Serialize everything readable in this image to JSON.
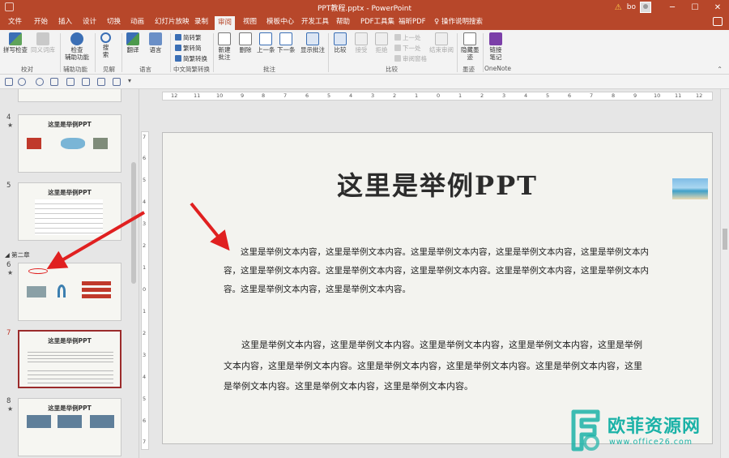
{
  "window": {
    "title": "PPT教程.pptx  -  PowerPoint",
    "user": "bo",
    "controls": [
      "─",
      "☐",
      "✕"
    ]
  },
  "tabs": [
    "文件",
    "开始",
    "插入",
    "设计",
    "切换",
    "动画",
    "幻灯片放映",
    "录制",
    "审阅",
    "视图",
    "模板中心",
    "开发工具",
    "帮助",
    "PDF工具集",
    "福昕PDF"
  ],
  "active_tab": "审阅",
  "tell_me": "操作说明搜索",
  "ribbon": {
    "spelling": "拼写检查",
    "thesaurus": "同义词库",
    "check_accessibility": [
      "检查",
      "辅助功能"
    ],
    "smart_lookup": [
      "搜",
      "索"
    ],
    "translate": "翻译",
    "language": "语言",
    "to_traditional": "简转繁",
    "to_simplified": "繁转简",
    "convert": "简繁转换",
    "new_comment": [
      "新建",
      "批注"
    ],
    "delete": "删除",
    "previous": "上一条",
    "next": "下一条",
    "show_comments": "显示批注",
    "compare": "比较",
    "accept": "接受",
    "reject": "拒绝",
    "prev_change": "上一处",
    "next_change": "下一处",
    "reviewing_pane": "审阅窗格",
    "end_review": "结束审阅",
    "hide_ink": [
      "隐藏墨",
      "迹"
    ],
    "linked_notes": [
      "链接",
      "笔记"
    ],
    "groups": {
      "proofing": "校对",
      "accessibility": "辅助功能",
      "insights": "见解",
      "language": "语言",
      "chinese_conversion": "中文简繁转换",
      "comments": "批注",
      "compare": "比较",
      "ink": "墨迹",
      "onenote": "OneNote"
    }
  },
  "thumbnails": {
    "section": "第二章",
    "slides": [
      {
        "num": "4",
        "title": "这里是举例PPT",
        "star": "★"
      },
      {
        "num": "5",
        "title": "这里是举例PPT",
        "star": ""
      },
      {
        "num": "6",
        "title": "",
        "star": "★"
      },
      {
        "num": "7",
        "title": "这里是举例PPT",
        "star": ""
      },
      {
        "num": "8",
        "title": "这里是举例PPT",
        "star": "★"
      }
    ]
  },
  "ruler": {
    "h_ticks": [
      "12",
      "11",
      "10",
      "9",
      "8",
      "7",
      "6",
      "5",
      "4",
      "3",
      "2",
      "1",
      "0",
      "1",
      "2",
      "3",
      "4",
      "5",
      "6",
      "7",
      "8",
      "9",
      "10",
      "11",
      "12"
    ],
    "v_ticks": [
      "7",
      "6",
      "5",
      "4",
      "3",
      "2",
      "1",
      "0",
      "1",
      "2",
      "3",
      "4",
      "5",
      "6",
      "7"
    ]
  },
  "slide": {
    "title": "这里是举例PPT",
    "paragraph1": "这里是举例文本内容，这里是举例文本内容。这里是举例文本内容，这里是举例文本内容，这里是举例文本内容，这里是举例文本内容。这里是举例文本内容，这里是举例文本内容。这里是举例文本内容，这里是举例文本内容。这里是举例文本内容，这里是举例文本内容。",
    "paragraph2": "这里是举例文本内容，这里是举例文本内容。这里是举例文本内容，这里是举例文本内容，这里是举例文本内容，这里是举例文本内容。这里是举例文本内容，这里是举例文本内容。这里是举例文本内容，这里是举例文本内容。这里是举例文本内容，这里是举例文本内容。"
  },
  "watermark": {
    "brand": "欧菲资源网",
    "site": "www.office26.com"
  },
  "colors": {
    "accent": "#b7472a",
    "selected_thumb": "#9b2b2b",
    "annotation_arrow": "#e02020",
    "watermark": "#1bb2a7"
  }
}
